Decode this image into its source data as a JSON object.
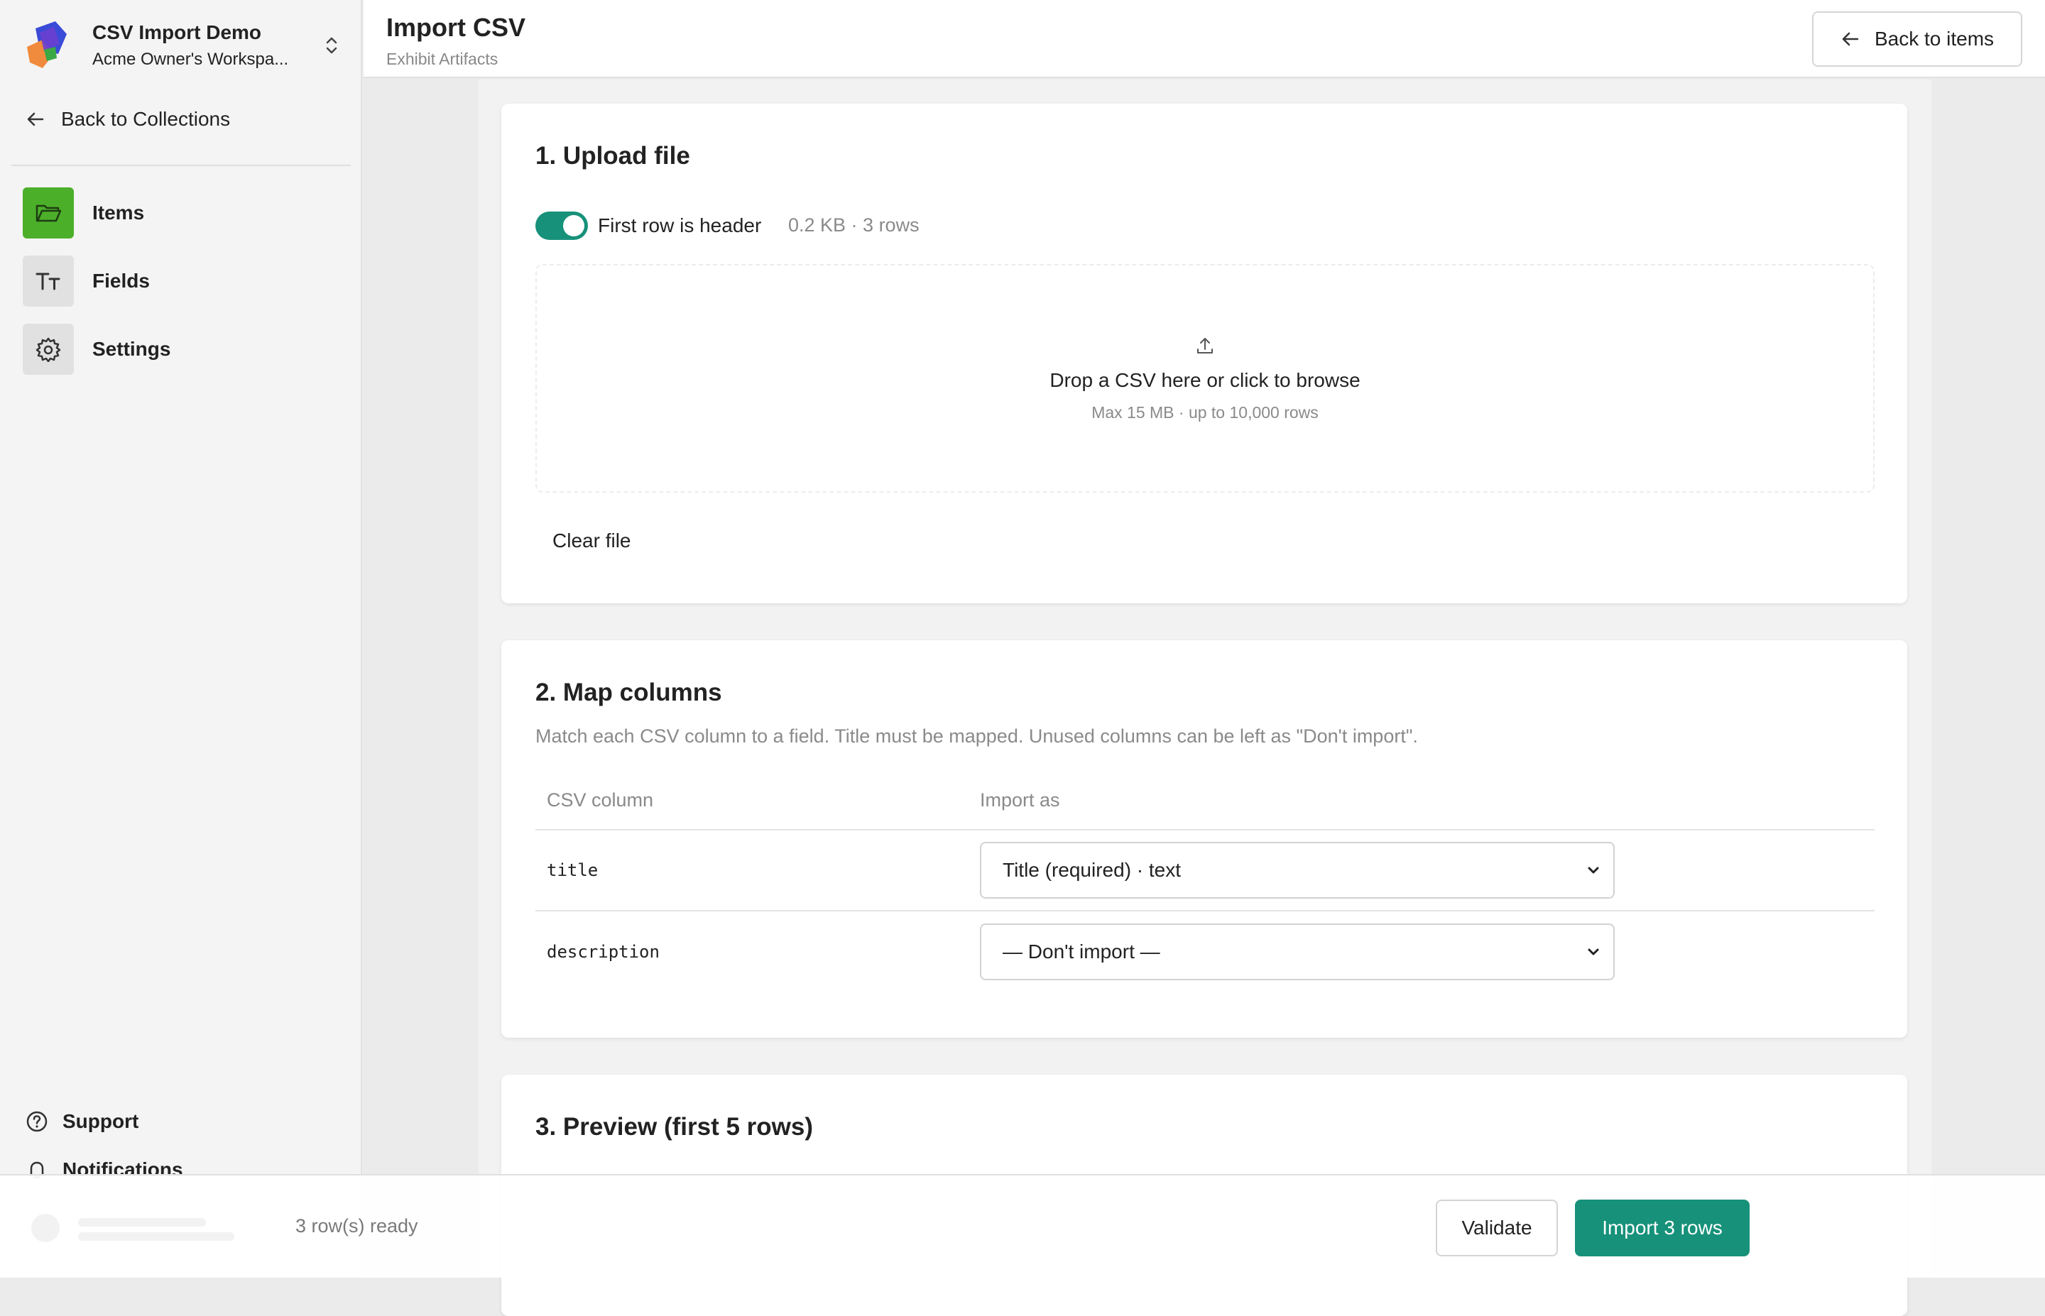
{
  "colors": {
    "accent": "#17917a",
    "nav_active": "#4caf2a"
  },
  "workspace": {
    "name": "CSV Import Demo",
    "subtitle": "Acme Owner's Workspa..."
  },
  "sidebar": {
    "back_label": "Back to Collections",
    "items": [
      {
        "label": "Items",
        "icon": "folder-icon",
        "active": true
      },
      {
        "label": "Fields",
        "icon": "text-type-icon",
        "active": false
      },
      {
        "label": "Settings",
        "icon": "gear-icon",
        "active": false
      }
    ],
    "bottom": [
      {
        "label": "Support",
        "icon": "help-circle-icon"
      },
      {
        "label": "Notifications",
        "icon": "bell-icon"
      }
    ]
  },
  "header": {
    "title": "Import CSV",
    "subtitle": "Exhibit Artifacts",
    "back_label": "Back to items"
  },
  "upload": {
    "title": "1. Upload file",
    "toggle_label": "First row is header",
    "toggle_on": true,
    "file_meta": "0.2 KB · 3 rows",
    "drop_main": "Drop a CSV here or click to browse",
    "drop_sub": "Max 15 MB · up to 10,000 rows",
    "clear_label": "Clear file"
  },
  "mapping": {
    "title": "2. Map columns",
    "description": "Match each CSV column to a field. Title must be mapped. Unused columns can be left as \"Don't import\".",
    "headers": {
      "csv_column": "CSV column",
      "import_as": "Import as"
    },
    "rows": [
      {
        "column": "title",
        "selected": "Title (required) · text"
      },
      {
        "column": "description",
        "selected": "— Don't import —"
      }
    ]
  },
  "preview": {
    "title": "3. Preview (first 5 rows)"
  },
  "footer": {
    "status": "3 row(s) ready",
    "validate_label": "Validate",
    "import_label": "Import 3 rows"
  }
}
